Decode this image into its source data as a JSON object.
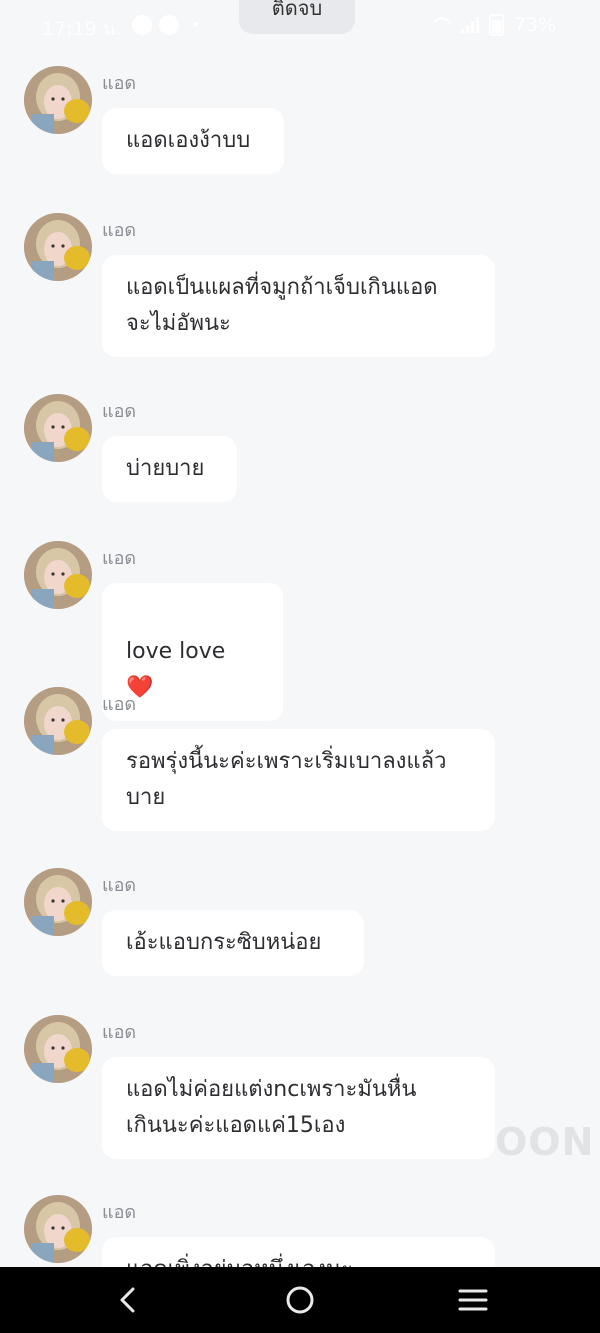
{
  "status_bar": {
    "time": "17:19 น.",
    "battery": "73%"
  },
  "top_pill": {
    "label": "ติดจบ"
  },
  "messages": [
    {
      "sender": "แอด",
      "text": "แอดเองง้าบบ"
    },
    {
      "sender": "แอด",
      "text": "แอดเป็นแผลที่จมูกถ้าเจ็บเกินแอด\nจะไม่อัพนะ"
    },
    {
      "sender": "แอด",
      "text": "บ่ายบาย"
    },
    {
      "sender": "แอด",
      "text": "love love",
      "emoji": "❤️"
    },
    {
      "sender": "แอด",
      "text": "รอพรุ่งนี้นะค่ะเพราะเริ่มเบาลงแล้ว\nบาย"
    },
    {
      "sender": "แอด",
      "text": "เอ้ะแอบกระซิบหน่อย"
    },
    {
      "sender": "แอด",
      "text": "แอดไม่ค่อยแต่งncเพราะมันหื่น\nเกินนะค่ะแอดแค่15เอง"
    },
    {
      "sender": "แอด",
      "text": "แอดเพิ่งอยู่มอหนึ่งเองนะ"
    }
  ],
  "watermark": {
    "text": "OON"
  },
  "colors": {
    "background": "#f6f7f9",
    "bubble": "#ffffff",
    "sender": "#8a8d93",
    "nav_bar": "#000000"
  },
  "icons": {
    "back": "back-icon",
    "home": "home-icon",
    "menu": "menu-icon"
  }
}
